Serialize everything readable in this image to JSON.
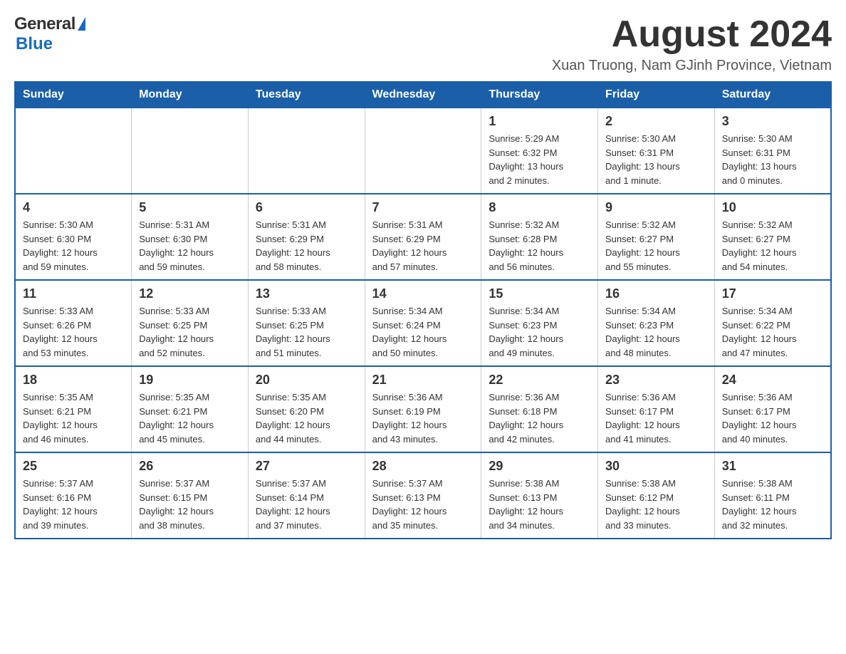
{
  "header": {
    "logo_general": "General",
    "logo_blue": "Blue",
    "month_title": "August 2024",
    "location": "Xuan Truong, Nam GJinh Province, Vietnam"
  },
  "days_of_week": [
    "Sunday",
    "Monday",
    "Tuesday",
    "Wednesday",
    "Thursday",
    "Friday",
    "Saturday"
  ],
  "weeks": [
    [
      {
        "day": "",
        "info": ""
      },
      {
        "day": "",
        "info": ""
      },
      {
        "day": "",
        "info": ""
      },
      {
        "day": "",
        "info": ""
      },
      {
        "day": "1",
        "info": "Sunrise: 5:29 AM\nSunset: 6:32 PM\nDaylight: 13 hours\nand 2 minutes."
      },
      {
        "day": "2",
        "info": "Sunrise: 5:30 AM\nSunset: 6:31 PM\nDaylight: 13 hours\nand 1 minute."
      },
      {
        "day": "3",
        "info": "Sunrise: 5:30 AM\nSunset: 6:31 PM\nDaylight: 13 hours\nand 0 minutes."
      }
    ],
    [
      {
        "day": "4",
        "info": "Sunrise: 5:30 AM\nSunset: 6:30 PM\nDaylight: 12 hours\nand 59 minutes."
      },
      {
        "day": "5",
        "info": "Sunrise: 5:31 AM\nSunset: 6:30 PM\nDaylight: 12 hours\nand 59 minutes."
      },
      {
        "day": "6",
        "info": "Sunrise: 5:31 AM\nSunset: 6:29 PM\nDaylight: 12 hours\nand 58 minutes."
      },
      {
        "day": "7",
        "info": "Sunrise: 5:31 AM\nSunset: 6:29 PM\nDaylight: 12 hours\nand 57 minutes."
      },
      {
        "day": "8",
        "info": "Sunrise: 5:32 AM\nSunset: 6:28 PM\nDaylight: 12 hours\nand 56 minutes."
      },
      {
        "day": "9",
        "info": "Sunrise: 5:32 AM\nSunset: 6:27 PM\nDaylight: 12 hours\nand 55 minutes."
      },
      {
        "day": "10",
        "info": "Sunrise: 5:32 AM\nSunset: 6:27 PM\nDaylight: 12 hours\nand 54 minutes."
      }
    ],
    [
      {
        "day": "11",
        "info": "Sunrise: 5:33 AM\nSunset: 6:26 PM\nDaylight: 12 hours\nand 53 minutes."
      },
      {
        "day": "12",
        "info": "Sunrise: 5:33 AM\nSunset: 6:25 PM\nDaylight: 12 hours\nand 52 minutes."
      },
      {
        "day": "13",
        "info": "Sunrise: 5:33 AM\nSunset: 6:25 PM\nDaylight: 12 hours\nand 51 minutes."
      },
      {
        "day": "14",
        "info": "Sunrise: 5:34 AM\nSunset: 6:24 PM\nDaylight: 12 hours\nand 50 minutes."
      },
      {
        "day": "15",
        "info": "Sunrise: 5:34 AM\nSunset: 6:23 PM\nDaylight: 12 hours\nand 49 minutes."
      },
      {
        "day": "16",
        "info": "Sunrise: 5:34 AM\nSunset: 6:23 PM\nDaylight: 12 hours\nand 48 minutes."
      },
      {
        "day": "17",
        "info": "Sunrise: 5:34 AM\nSunset: 6:22 PM\nDaylight: 12 hours\nand 47 minutes."
      }
    ],
    [
      {
        "day": "18",
        "info": "Sunrise: 5:35 AM\nSunset: 6:21 PM\nDaylight: 12 hours\nand 46 minutes."
      },
      {
        "day": "19",
        "info": "Sunrise: 5:35 AM\nSunset: 6:21 PM\nDaylight: 12 hours\nand 45 minutes."
      },
      {
        "day": "20",
        "info": "Sunrise: 5:35 AM\nSunset: 6:20 PM\nDaylight: 12 hours\nand 44 minutes."
      },
      {
        "day": "21",
        "info": "Sunrise: 5:36 AM\nSunset: 6:19 PM\nDaylight: 12 hours\nand 43 minutes."
      },
      {
        "day": "22",
        "info": "Sunrise: 5:36 AM\nSunset: 6:18 PM\nDaylight: 12 hours\nand 42 minutes."
      },
      {
        "day": "23",
        "info": "Sunrise: 5:36 AM\nSunset: 6:17 PM\nDaylight: 12 hours\nand 41 minutes."
      },
      {
        "day": "24",
        "info": "Sunrise: 5:36 AM\nSunset: 6:17 PM\nDaylight: 12 hours\nand 40 minutes."
      }
    ],
    [
      {
        "day": "25",
        "info": "Sunrise: 5:37 AM\nSunset: 6:16 PM\nDaylight: 12 hours\nand 39 minutes."
      },
      {
        "day": "26",
        "info": "Sunrise: 5:37 AM\nSunset: 6:15 PM\nDaylight: 12 hours\nand 38 minutes."
      },
      {
        "day": "27",
        "info": "Sunrise: 5:37 AM\nSunset: 6:14 PM\nDaylight: 12 hours\nand 37 minutes."
      },
      {
        "day": "28",
        "info": "Sunrise: 5:37 AM\nSunset: 6:13 PM\nDaylight: 12 hours\nand 35 minutes."
      },
      {
        "day": "29",
        "info": "Sunrise: 5:38 AM\nSunset: 6:13 PM\nDaylight: 12 hours\nand 34 minutes."
      },
      {
        "day": "30",
        "info": "Sunrise: 5:38 AM\nSunset: 6:12 PM\nDaylight: 12 hours\nand 33 minutes."
      },
      {
        "day": "31",
        "info": "Sunrise: 5:38 AM\nSunset: 6:11 PM\nDaylight: 12 hours\nand 32 minutes."
      }
    ]
  ]
}
